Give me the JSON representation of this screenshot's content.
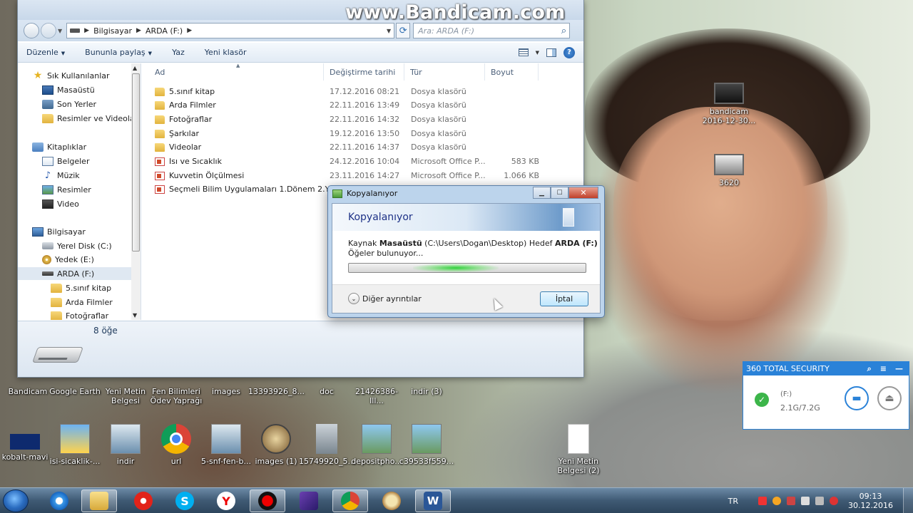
{
  "watermark": "www.Bandicam.com",
  "explorer": {
    "address": [
      "Bilgisayar",
      "ARDA (F:)"
    ],
    "search_placeholder": "Ara: ARDA (F:)",
    "toolbar": {
      "organize": "Düzenle",
      "share": "Bununla paylaş",
      "print": "Yaz",
      "new_folder": "Yeni klasör"
    },
    "nav": {
      "favorites": "Sık Kullanılanlar",
      "desktop": "Masaüstü",
      "recent": "Son Yerler",
      "pics_videos": "Resimler ve Videolar",
      "libraries": "Kitaplıklar",
      "documents": "Belgeler",
      "music": "Müzik",
      "pictures": "Resimler",
      "video": "Video",
      "computer": "Bilgisayar",
      "local_disk": "Yerel Disk (C:)",
      "backup": "Yedek (E:)",
      "arda": "ARDA (F:)",
      "sub1": "5.sınıf kitap",
      "sub2": "Arda Filmler",
      "sub3": "Fotoğraflar"
    },
    "columns": {
      "name": "Ad",
      "date": "Değiştirme tarihi",
      "type": "Tür",
      "size": "Boyut"
    },
    "files": [
      {
        "name": "5.sınıf kitap",
        "date": "17.12.2016 08:21",
        "type": "Dosya klasörü",
        "size": "",
        "icon": "folder"
      },
      {
        "name": "Arda Filmler",
        "date": "22.11.2016 13:49",
        "type": "Dosya klasörü",
        "size": "",
        "icon": "folder"
      },
      {
        "name": "Fotoğraflar",
        "date": "22.11.2016 14:32",
        "type": "Dosya klasörü",
        "size": "",
        "icon": "folder"
      },
      {
        "name": "Şarkılar",
        "date": "19.12.2016 13:50",
        "type": "Dosya klasörü",
        "size": "",
        "icon": "folder"
      },
      {
        "name": "Videolar",
        "date": "22.11.2016 14:37",
        "type": "Dosya klasörü",
        "size": "",
        "icon": "folder"
      },
      {
        "name": "Isı ve Sıcaklık",
        "date": "24.12.2016 10:04",
        "type": "Microsoft Office P...",
        "size": "583 KB",
        "icon": "ppt"
      },
      {
        "name": "Kuvvetin Ölçülmesi",
        "date": "23.11.2016 14:27",
        "type": "Microsoft Office P...",
        "size": "1.066 KB",
        "icon": "ppt"
      },
      {
        "name": "Seçmeli Bilim Uygulamaları 1.Dönem 2.Y...",
        "date": "",
        "type": "",
        "size": "",
        "icon": "ppt"
      }
    ],
    "item_count": "8 öğe"
  },
  "dialog": {
    "title": "Kopyalanıyor",
    "heading": "Kopyalanıyor",
    "source_label": "Kaynak",
    "source": "Masaüstü",
    "source_path": "(C:\\Users\\Dogan\\Desktop)",
    "dest_label": "Hedef",
    "dest": "ARDA (F:)",
    "status": "Öğeler bulunuyor...",
    "more_details": "Diğer ayrıntılar",
    "cancel": "İptal"
  },
  "desktop_icons": [
    {
      "label": "bandicam 2016-12-30...",
      "icon": "film-icon"
    },
    {
      "label": "3620",
      "icon": "image-icon"
    },
    {
      "label": "Bandicam",
      "icon": "app-icon"
    },
    {
      "label": "Google Earth",
      "icon": "app-icon"
    },
    {
      "label": "Yeni Metin Belgesi",
      "icon": "doc-icon"
    },
    {
      "label": "Fen Bilimleri Ödev Yaprağı",
      "icon": "doc-icon"
    },
    {
      "label": "images",
      "icon": "image-icon"
    },
    {
      "label": "13393926_8...",
      "icon": "image-icon"
    },
    {
      "label": "doc",
      "icon": "doc-icon"
    },
    {
      "label": "21426386-Ill...",
      "icon": "image-icon"
    },
    {
      "label": "indir (3)",
      "icon": "image-icon"
    },
    {
      "label": "kobalt-mavi",
      "icon": "image-icon"
    },
    {
      "label": "isi-sicaklik-...",
      "icon": "image-icon"
    },
    {
      "label": "indir",
      "icon": "image-icon"
    },
    {
      "label": "url",
      "icon": "chrome-icon"
    },
    {
      "label": "5-snf-fen-b...",
      "icon": "image-icon"
    },
    {
      "label": "images (1)",
      "icon": "image-icon"
    },
    {
      "label": "15749920_5...",
      "icon": "image-icon"
    },
    {
      "label": "depositpho...",
      "icon": "image-icon"
    },
    {
      "label": "c39533f559...",
      "icon": "image-icon"
    },
    {
      "label": "Yeni Metin Belgesi (2)",
      "icon": "doc-icon"
    }
  ],
  "security": {
    "title": "360 TOTAL SECURITY",
    "drive": "(F:)",
    "usage": "2.1G/7.2G"
  },
  "taskbar": {
    "lang": "TR",
    "time": "09:13",
    "date": "30.12.2016"
  }
}
